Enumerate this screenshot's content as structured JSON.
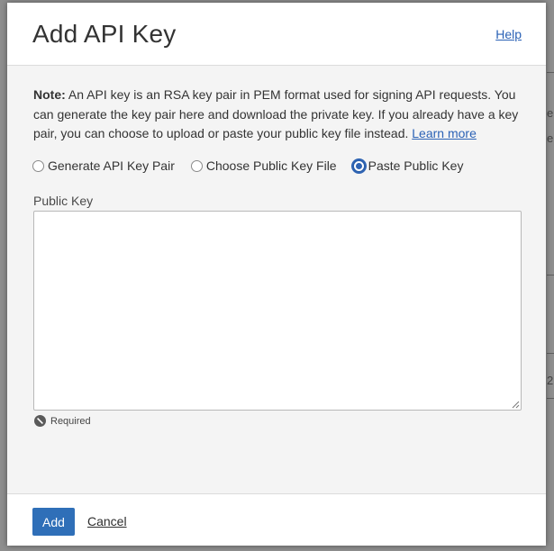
{
  "dialog": {
    "title": "Add API Key",
    "help_label": "Help"
  },
  "note": {
    "label": "Note:",
    "text": "An API key is an RSA key pair in PEM format used for signing API requests. You can generate the key pair here and download the private key. If you already have a key pair, you can choose to upload or paste your public key file instead.",
    "link_label": "Learn more"
  },
  "key_options": {
    "selected": "Paste Public Key",
    "items": [
      {
        "label": "Generate API Key Pair",
        "checked": false
      },
      {
        "label": "Choose Public Key File",
        "checked": false
      },
      {
        "label": "Paste Public Key",
        "checked": true
      }
    ]
  },
  "public_key": {
    "label": "Public Key",
    "value": "",
    "required_text": "Required"
  },
  "footer": {
    "add_label": "Add",
    "cancel_label": "Cancel"
  },
  "colors": {
    "accent": "#2f6fb8",
    "link": "#2b62b6",
    "dialog_body": "#f4f4f4",
    "overlay": "#8e8e8e"
  },
  "icons": {
    "required": "prohibited-circle-icon",
    "resize": "resize-grip-icon"
  }
}
